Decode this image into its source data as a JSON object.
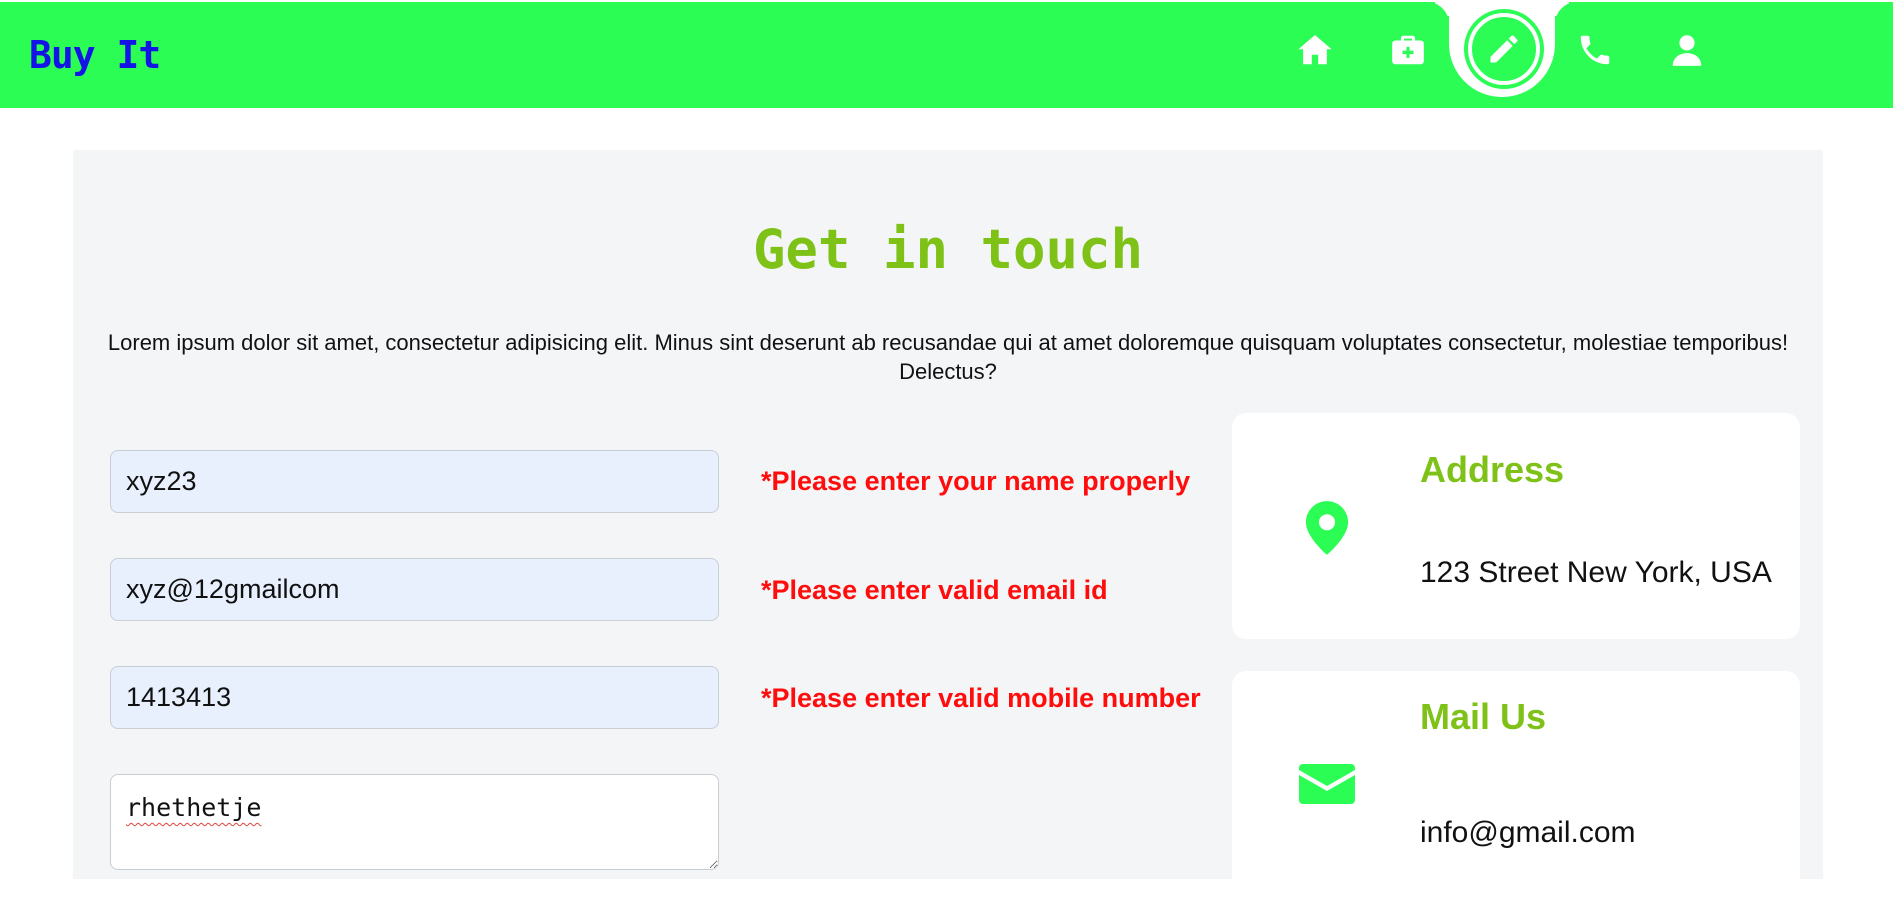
{
  "colors": {
    "brand": "#2bfd55",
    "accent": "#7ec218",
    "logo": "#1414e6",
    "error": "#ff0d0d"
  },
  "navbar": {
    "logo": "Buy It",
    "items": [
      {
        "icon": "home-icon"
      },
      {
        "icon": "medical-bag-icon"
      },
      {
        "icon": "pencil-icon",
        "active": true
      },
      {
        "icon": "phone-icon"
      },
      {
        "icon": "user-icon"
      }
    ]
  },
  "contact": {
    "title": "Get in touch",
    "description": "Lorem ipsum dolor sit amet, consectetur adipisicing elit. Minus sint deserunt ab recusandae qui at amet doloremque quisquam voluptates consectetur, molestiae temporibus! Delectus?",
    "form": {
      "name_value": "xyz23",
      "email_value": "xyz@12gmailcom",
      "mobile_value": "1413413",
      "message_value": "rhethetje"
    },
    "errors": {
      "name": "*Please enter your name properly",
      "email": "*Please enter valid email id",
      "mobile": "*Please enter valid mobile number"
    },
    "cards": {
      "address": {
        "icon": "map-pin-icon",
        "title": "Address",
        "text": "123 Street New York, USA"
      },
      "mail": {
        "icon": "envelope-icon",
        "title": "Mail Us",
        "text": "info@gmail.com"
      }
    }
  }
}
